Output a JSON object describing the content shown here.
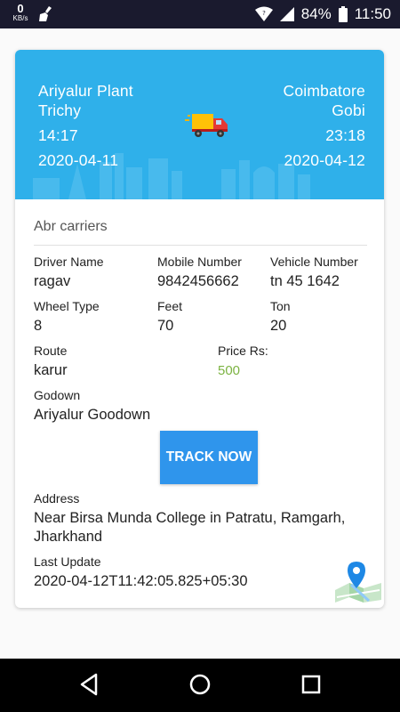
{
  "status_bar": {
    "net_speed": "0",
    "net_unit": "KB/s",
    "battery": "84%",
    "time": "11:50"
  },
  "trip": {
    "from_place": "Ariyalur Plant",
    "from_city": "Trichy",
    "from_time": "14:17",
    "from_date": "2020-04-11",
    "to_place": "Coimbatore",
    "to_city": "Gobi",
    "to_time": "23:18",
    "to_date": "2020-04-12"
  },
  "carrier_name": "Abr carriers",
  "details": {
    "driver_name_label": "Driver Name",
    "driver_name": "ragav",
    "mobile_label": "Mobile Number",
    "mobile": "9842456662",
    "vehicle_label": "Vehicle Number",
    "vehicle": "tn 45 1642",
    "wheel_label": "Wheel Type",
    "wheel": "8",
    "feet_label": "Feet",
    "feet": "70",
    "ton_label": "Ton",
    "ton": "20",
    "route_label": "Route",
    "route": "karur",
    "price_label": "Price Rs:",
    "price": "500",
    "godown_label": "Godown",
    "godown": "Ariyalur Goodown",
    "track_button": "TRACK NOW",
    "address_label": "Address",
    "address_line1": "Near Birsa Munda College in Patratu, Ramgarh,",
    "address_line2": "Jharkhand",
    "last_update_label": "Last Update",
    "last_update": "2020-04-12T11:42:05.825+05:30"
  },
  "colors": {
    "hero": "#2fb0ea",
    "button": "#2f95ec",
    "price": "#7cb342"
  },
  "icons": [
    "cleaner-icon",
    "wifi-icon",
    "signal-icon",
    "battery-icon",
    "truck-icon",
    "map-pin-icon",
    "back-icon",
    "home-icon",
    "recents-icon"
  ]
}
